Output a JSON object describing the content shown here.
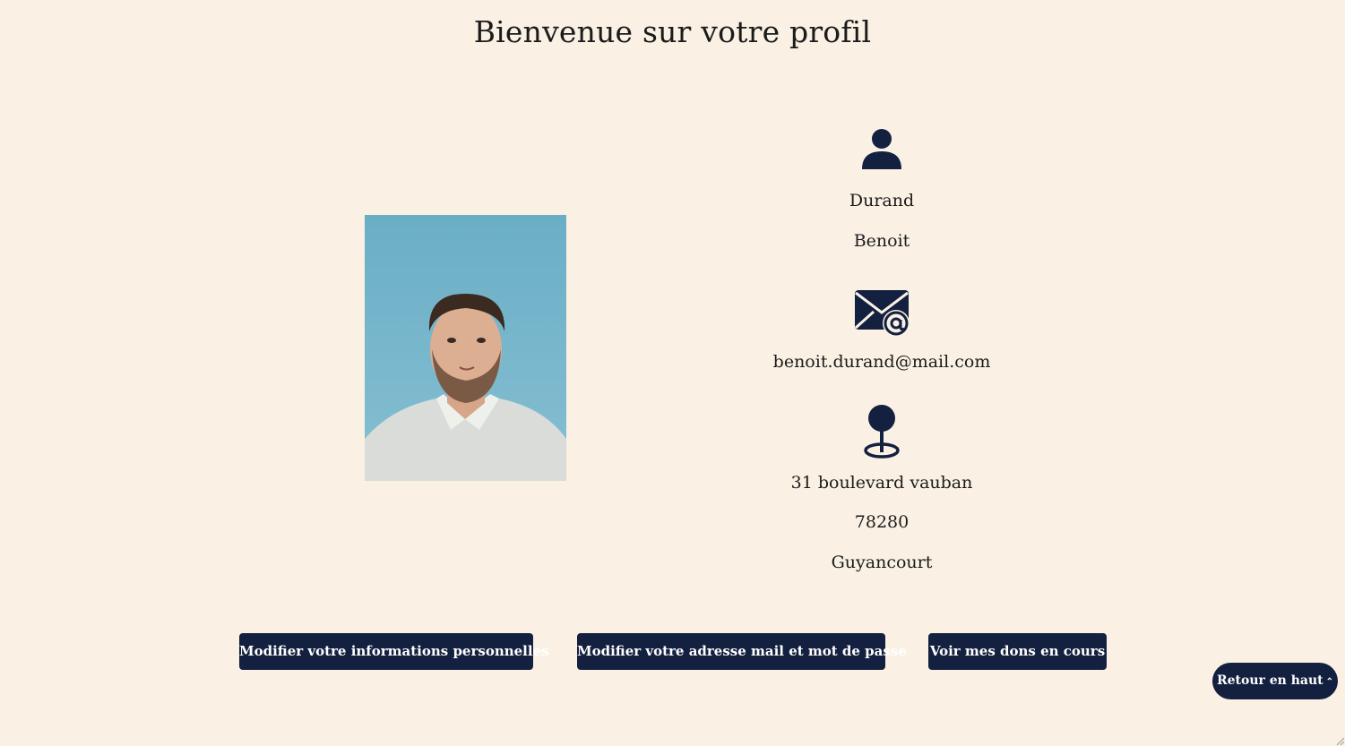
{
  "page": {
    "title": "Bienvenue sur votre profil"
  },
  "profile": {
    "last_name": "Durand",
    "first_name": "Benoit",
    "email": "benoit.durand@mail.com",
    "address_street": "31 boulevard vauban",
    "postal_code": "78280",
    "city": "Guyancourt"
  },
  "icons": {
    "user": "user-icon",
    "email": "email-at-icon",
    "location": "map-pin-icon"
  },
  "actions": {
    "edit_info_label": "Modifier votre informations personnelles",
    "edit_email_password_label": "Modifier votre adresse mail et mot de passe",
    "view_donations_label": "Voir mes dons en cours",
    "back_to_top_label": "Retour en haut"
  },
  "colors": {
    "background": "#faf1e4",
    "primary": "#14203f",
    "text": "#1b1b1b"
  }
}
